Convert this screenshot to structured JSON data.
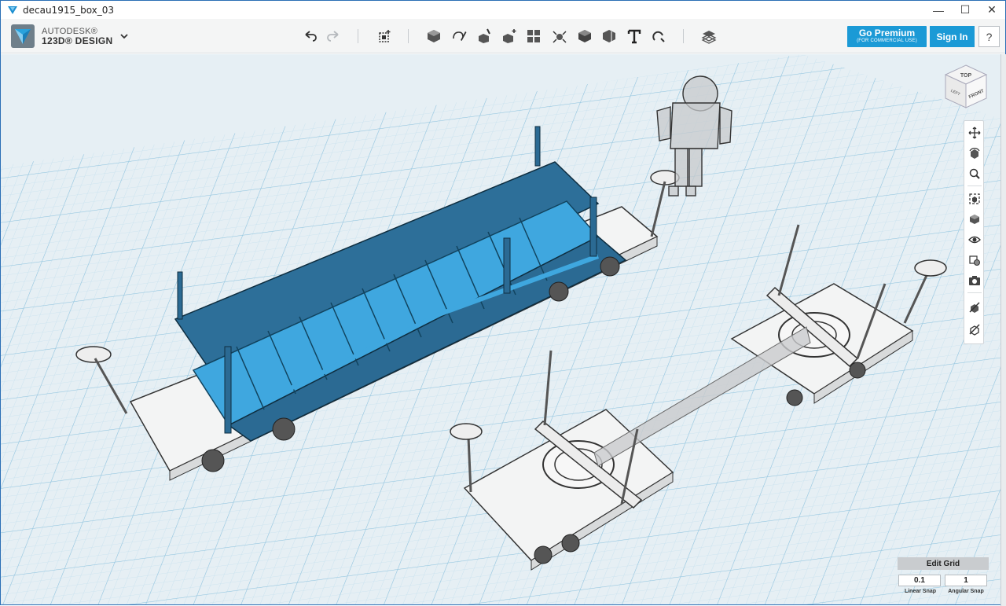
{
  "window": {
    "title": "decau1915_box_03",
    "minimize_glyph": "—",
    "maximize_glyph": "☐",
    "close_glyph": "✕"
  },
  "brand": {
    "line1": "AUTODESK®",
    "line2": "123D® DESIGN",
    "menu_icon": "chevron-down-icon"
  },
  "toolbar": {
    "tools": [
      {
        "name": "undo-icon"
      },
      {
        "name": "redo-icon"
      },
      {
        "name": "transform-icon"
      },
      {
        "name": "primitives-icon"
      },
      {
        "name": "sketch-icon"
      },
      {
        "name": "construct-icon"
      },
      {
        "name": "modify-icon"
      },
      {
        "name": "pattern-icon"
      },
      {
        "name": "group-icon"
      },
      {
        "name": "combine-icon"
      },
      {
        "name": "measure-icon"
      },
      {
        "name": "text-icon"
      },
      {
        "name": "snap-icon"
      },
      {
        "name": "material-icon"
      }
    ]
  },
  "account": {
    "premium_label": "Go Premium",
    "premium_sublabel": "(FOR COMMERCIAL USE)",
    "signin_label": "Sign In",
    "help_label": "?"
  },
  "viewcube": {
    "top": "TOP",
    "front": "FRONT",
    "left": "LEFT"
  },
  "nav_tools": [
    {
      "name": "pan-icon"
    },
    {
      "name": "orbit-icon"
    },
    {
      "name": "zoom-icon"
    },
    {
      "name": "fit-icon"
    },
    {
      "name": "views-icon"
    },
    {
      "name": "visibility-icon"
    },
    {
      "name": "material-toggle-icon"
    },
    {
      "name": "camera-icon"
    },
    {
      "name": "hide-icon"
    },
    {
      "name": "settings-icon"
    }
  ],
  "grid": {
    "edit_label": "Edit Grid",
    "linear_snap_value": "0.1",
    "angular_snap_value": "1",
    "linear_snap_label": "Linear Snap",
    "angular_snap_label": "Angular Snap"
  },
  "colors": {
    "accent": "#1b9ad6",
    "grid_bg": "#e6eff4",
    "grid_line": "#a9d1e6",
    "selected_body": "#3a9dd6",
    "selected_dark": "#1f5f86"
  }
}
